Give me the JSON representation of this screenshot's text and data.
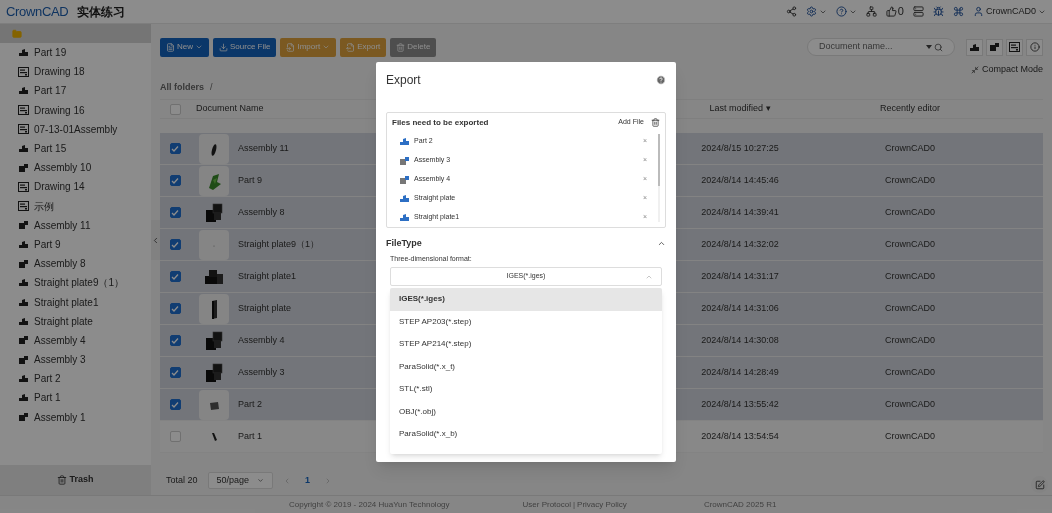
{
  "header": {
    "logo": "CrownCAD",
    "title": "实体练习",
    "likes": "0",
    "user": "CrownCAD0"
  },
  "sidebar": {
    "root": {
      "selected": true
    },
    "items": [
      {
        "label": "Part 19",
        "kind": "part"
      },
      {
        "label": "Drawing 18",
        "kind": "drawing"
      },
      {
        "label": "Part 17",
        "kind": "part"
      },
      {
        "label": "Drawing 16",
        "kind": "drawing"
      },
      {
        "label": "07-13-01Assembly",
        "kind": "drawing"
      },
      {
        "label": "Part 15",
        "kind": "part"
      },
      {
        "label": "Assembly 10",
        "kind": "assembly"
      },
      {
        "label": "Drawing 14",
        "kind": "drawing"
      },
      {
        "label": "示例",
        "kind": "drawing"
      },
      {
        "label": "Assembly 11",
        "kind": "assembly"
      },
      {
        "label": "Part 9",
        "kind": "part"
      },
      {
        "label": "Assembly 8",
        "kind": "assembly"
      },
      {
        "label": "Straight plate9（1）",
        "kind": "part"
      },
      {
        "label": "Straight plate1",
        "kind": "part"
      },
      {
        "label": "Straight plate",
        "kind": "part"
      },
      {
        "label": "Assembly 4",
        "kind": "assembly"
      },
      {
        "label": "Assembly 3",
        "kind": "assembly"
      },
      {
        "label": "Part 2",
        "kind": "part"
      },
      {
        "label": "Part 1",
        "kind": "part"
      },
      {
        "label": "Assembly 1",
        "kind": "assembly"
      }
    ],
    "trash": "Trash"
  },
  "toolbar": {
    "buttons": [
      {
        "label": "New",
        "kind": "primary",
        "menu": true
      },
      {
        "label": "Source File",
        "kind": "primary",
        "menu": false
      },
      {
        "label": "Import",
        "kind": "warning",
        "menu": true
      },
      {
        "label": "Export",
        "kind": "warning",
        "menu": false
      },
      {
        "label": "Delete",
        "kind": "muted",
        "menu": false
      }
    ],
    "search": {
      "placeholder": "Document name..."
    },
    "compact_mode": "Compact Mode"
  },
  "breadcrumb": {
    "root": "All folders",
    "separator": "/"
  },
  "table": {
    "all_checked": false,
    "columns": [
      "Document Name",
      "Last modified ▾",
      "Recently editor"
    ],
    "rows": [
      {
        "checked": true,
        "kind": "sliver",
        "name": "Assembly 11",
        "modified": "2024/8/15 10:27:25",
        "editor": "CrownCAD0"
      },
      {
        "checked": true,
        "kind": "leaf",
        "name": "Part 9",
        "modified": "2024/8/14 14:45:46",
        "editor": "CrownCAD0"
      },
      {
        "checked": true,
        "kind": "cubes",
        "name": "Assembly 8",
        "modified": "2024/8/14 14:39:41",
        "editor": "CrownCAD0"
      },
      {
        "checked": true,
        "kind": "blank",
        "name": "Straight plate9（1）",
        "modified": "2024/8/14 14:32:02",
        "editor": "CrownCAD0"
      },
      {
        "checked": true,
        "kind": "steps",
        "name": "Straight plate1",
        "modified": "2024/8/14 14:31:17",
        "editor": "CrownCAD0"
      },
      {
        "checked": true,
        "kind": "plate",
        "name": "Straight plate",
        "modified": "2024/8/14 14:31:06",
        "editor": "CrownCAD0"
      },
      {
        "checked": true,
        "kind": "cubes",
        "name": "Assembly 4",
        "modified": "2024/8/14 14:30:08",
        "editor": "CrownCAD0"
      },
      {
        "checked": true,
        "kind": "cubes",
        "name": "Assembly 3",
        "modified": "2024/8/14 14:28:49",
        "editor": "CrownCAD0"
      },
      {
        "checked": true,
        "kind": "chip",
        "name": "Part 2",
        "modified": "2024/8/14 13:55:42",
        "editor": "CrownCAD0"
      },
      {
        "checked": false,
        "kind": "stick",
        "name": "Part 1",
        "modified": "2024/8/14 13:54:54",
        "editor": "CrownCAD0"
      }
    ]
  },
  "pagination": {
    "total": "Total 20",
    "page_size": "50/page",
    "pages": [
      {
        "label": "1",
        "selected": true
      }
    ]
  },
  "footer": {
    "copyright": "Copyright © 2019 - 2024 HuaYun Technology",
    "user_protocol": "User Protocol",
    "separator": "|",
    "privacy": "Privacy Policy",
    "version": "CrownCAD 2025 R1"
  },
  "dialog": {
    "title": "Export",
    "files": {
      "title": "Files need to be exported",
      "add": "Add File",
      "items": [
        {
          "name": "Part 2",
          "kind": "part"
        },
        {
          "name": "Assembly 3",
          "kind": "assembly"
        },
        {
          "name": "Assembly 4",
          "kind": "assembly"
        },
        {
          "name": "Straight plate",
          "kind": "part"
        },
        {
          "name": "Straight plate1",
          "kind": "part"
        }
      ],
      "remove": "×"
    },
    "filetype": {
      "title": "FileType",
      "expanded": true,
      "label": "Three-dimensional format:",
      "value": "IGES(*.iges)",
      "open": true,
      "options": [
        {
          "label": "IGES(*.iges)",
          "selected": true
        },
        {
          "label": "STEP AP203(*.step)",
          "selected": false
        },
        {
          "label": "STEP AP214(*.step)",
          "selected": false
        },
        {
          "label": "ParaSolid(*.x_t)",
          "selected": false
        },
        {
          "label": "STL(*.stl)",
          "selected": false
        },
        {
          "label": "OBJ(*.obj)",
          "selected": false
        },
        {
          "label": "ParaSolid(*.x_b)",
          "selected": false
        }
      ]
    }
  }
}
